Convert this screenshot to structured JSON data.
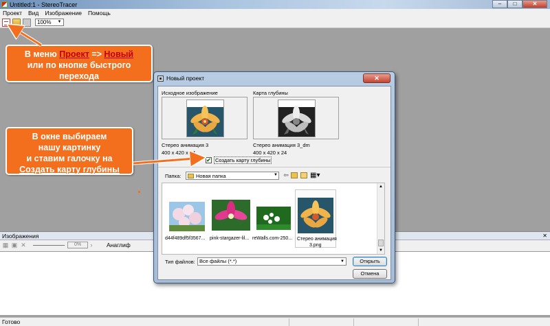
{
  "window": {
    "title": "Untitled:1 - StereoTracer",
    "min": "–",
    "max": "□",
    "close": "✕"
  },
  "menu": [
    "Проект",
    "Вид",
    "Изображение",
    "Помощь"
  ],
  "toolbar": {
    "zoom_value": "100%",
    "icons": [
      "new-project-icon",
      "open-icon",
      "save-icon"
    ]
  },
  "callouts": {
    "first": {
      "line1_pre": "В меню ",
      "line1_link1": "Проект",
      "line1_mid": " => ",
      "line1_link2": "Новый",
      "line2": "или по кнопке быстрого",
      "line3": "перехода"
    },
    "second": {
      "line1": "В окне выбираем",
      "line2": "нашу картинку",
      "line3": "и ставим галочку на",
      "line4": "Создать карту глубины"
    }
  },
  "images_panel": {
    "title": "Изображения",
    "close": "✕",
    "percent": "0%",
    "anaglyph": "Анаглиф"
  },
  "status": {
    "text": "Готово"
  },
  "dialog": {
    "title": "Новый проект",
    "close": "✕",
    "source_label": "Исходное изображение",
    "depth_label": "Карта глубины",
    "source_name": "Стерео анимация 3",
    "source_size": "400 x 420 x 24",
    "depth_name": "Стерео анимация 3_dm",
    "depth_size": "400 x 420 x 24",
    "checkbox_label": "Создать карту глубины",
    "checkbox_mark": "✔",
    "folder_label": "Папка:",
    "folder_value": "Новая папка",
    "files": [
      {
        "name": "d44f489df5f3567..."
      },
      {
        "name": "pink-stargazer-lil..."
      },
      {
        "name": "reWalls.com-250..."
      },
      {
        "name": "Стерео анимация",
        "name2": "3.png"
      }
    ],
    "filetype_label": "Тип файлов:",
    "filetype_value": "Все файлы (*.*)",
    "open_button": "Открыть",
    "cancel_button": "Отмена"
  },
  "colors": {
    "callout": "#f36f1d",
    "workspace": "#a0a0a0"
  }
}
